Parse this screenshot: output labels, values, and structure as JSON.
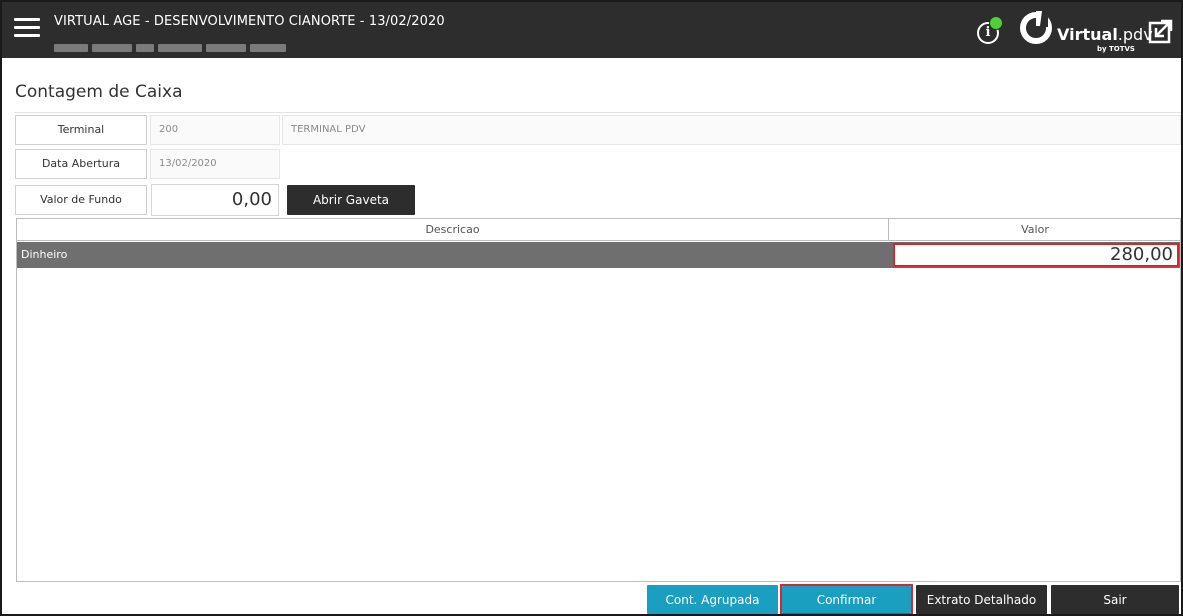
{
  "header": {
    "title": "VIRTUAL AGE - DESENVOLVIMENTO CIANORTE - 13/02/2020",
    "logo_text_bold": "Virtual",
    "logo_text_light": ".pdv",
    "logo_sub": "by TOTVS",
    "status_color": "#4cd137",
    "icons": [
      "menu-icon",
      "info-icon",
      "virtualpdv-logo",
      "popout-icon"
    ]
  },
  "page": {
    "title": "Contagem de Caixa"
  },
  "form": {
    "terminal": {
      "label": "Terminal",
      "code": "200",
      "name": "TERMINAL PDV"
    },
    "data_abertura": {
      "label": "Data Abertura",
      "value": "13/02/2020"
    },
    "valor_fundo": {
      "label": "Valor de Fundo",
      "value": "0,00"
    },
    "abrir_gaveta_label": "Abrir Gaveta"
  },
  "grid": {
    "columns": [
      "Descricao",
      "Valor"
    ],
    "rows": [
      {
        "descricao": "Dinheiro",
        "valor": "280,00"
      }
    ]
  },
  "actions": {
    "cont_agrupada": "Cont. Agrupada",
    "confirmar": "Confirmar",
    "extrato_detalhado": "Extrato Detalhado",
    "sair": "Sair"
  },
  "colors": {
    "header_bg": "#2d2d2d",
    "accent_teal": "#1a9fc1",
    "highlight_red": "#d9262c",
    "selected_row": "#6f6f6f"
  }
}
